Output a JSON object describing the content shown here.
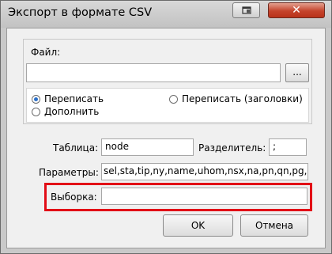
{
  "window": {
    "title": "Экспорт в формате CSV"
  },
  "file": {
    "group_label": "Файл:",
    "value": "",
    "browse_label": "..."
  },
  "mode": {
    "options": [
      "Переписать",
      "Переписать (заголовки)",
      "Дополнить"
    ],
    "selected": "Переписать"
  },
  "table": {
    "label": "Таблица:",
    "value": "node"
  },
  "separator": {
    "label": "Разделитель:",
    "value": ";"
  },
  "params": {
    "label": "Параметры:",
    "value": "sel,sta,tip,ny,name,uhom,nsx,na,pn,qn,pg,qg"
  },
  "selection": {
    "label": "Выборка:",
    "value": ""
  },
  "buttons": {
    "ok": "OK",
    "cancel": "Отмена"
  },
  "colors": {
    "highlight": "#e20c16",
    "close_button": "#c5432b",
    "radio_accent": "#2a6fc9"
  }
}
